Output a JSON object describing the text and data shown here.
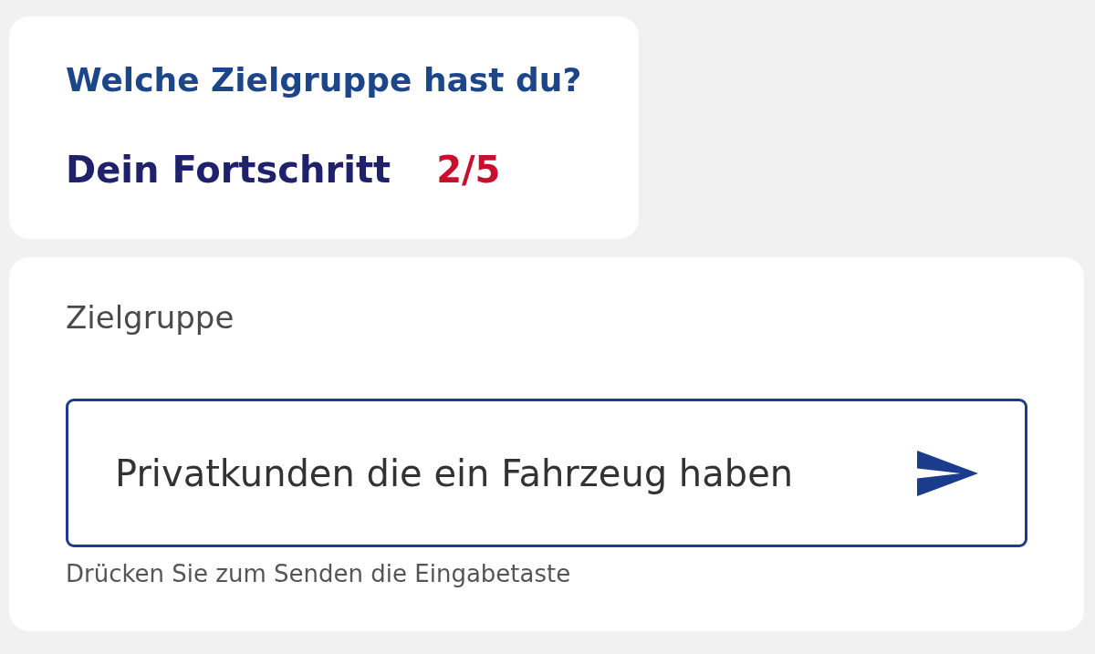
{
  "question_card": {
    "title": "Welche Zielgruppe hast du?",
    "progress_label": "Dein Fortschritt",
    "progress_value": "2/5"
  },
  "answer_card": {
    "label": "Zielgruppe",
    "input": {
      "value": "Privatkunden die ein Fahrzeug haben"
    },
    "hint": "Drücken Sie zum Senden die Eingabetaste"
  }
}
